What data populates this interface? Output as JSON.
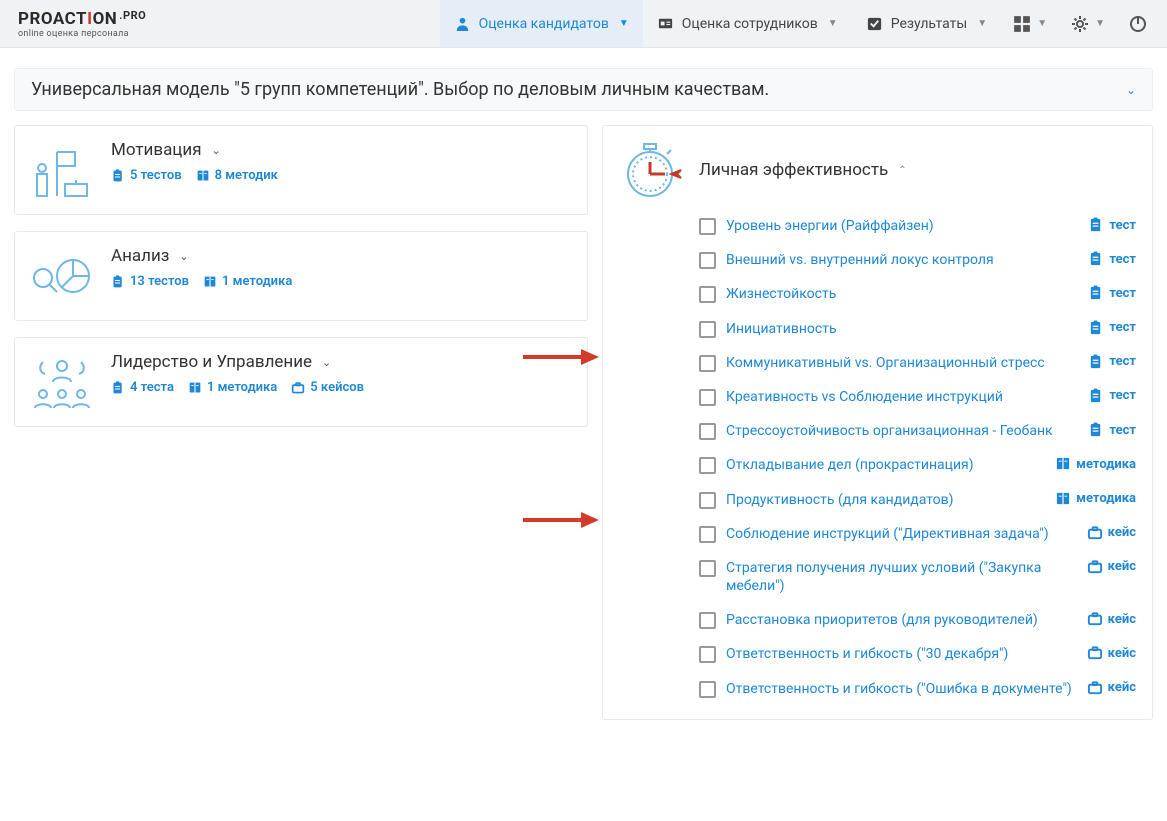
{
  "header": {
    "logo_main": "PROACTION",
    "logo_ext": ".PRO",
    "logo_sub": "online оценка персонала",
    "nav": [
      {
        "label": "Оценка кандидатов",
        "active": true,
        "icon": "user"
      },
      {
        "label": "Оценка сотрудников",
        "active": false,
        "icon": "id"
      },
      {
        "label": "Результаты",
        "active": false,
        "icon": "check"
      }
    ]
  },
  "page_title": "Универсальная модель \"5 групп компетенций\". Выбор по деловым личным качествам.",
  "left_cards": [
    {
      "title": "Мотивация",
      "meta": [
        {
          "n": "5 тестов",
          "icon": "clip"
        },
        {
          "n": "8 методик",
          "icon": "book"
        }
      ]
    },
    {
      "title": "Анализ",
      "meta": [
        {
          "n": "13 тестов",
          "icon": "clip"
        },
        {
          "n": "1 методика",
          "icon": "book"
        }
      ]
    },
    {
      "title": "Лидерство и Управление",
      "meta": [
        {
          "n": "4 теста",
          "icon": "clip"
        },
        {
          "n": "1 методика",
          "icon": "book"
        },
        {
          "n": "5 кейсов",
          "icon": "case"
        }
      ]
    }
  ],
  "right_card": {
    "title": "Личная эффективность",
    "items": [
      {
        "label": "Уровень энергии (Райффайзен)",
        "tag": "тест",
        "tagicon": "clip"
      },
      {
        "label": "Внешний vs. внутренний локус контроля",
        "tag": "тест",
        "tagicon": "clip"
      },
      {
        "label": "Жизнестойкость",
        "tag": "тест",
        "tagicon": "clip"
      },
      {
        "label": "Инициативность",
        "tag": "тест",
        "tagicon": "clip"
      },
      {
        "label": "Коммуникативный vs. Организационный стресс",
        "tag": "тест",
        "tagicon": "clip"
      },
      {
        "label": "Креативность vs Соблюдение инструкций",
        "tag": "тест",
        "tagicon": "clip"
      },
      {
        "label": "Стрессоустойчивость организационная - Геобанк",
        "tag": "тест",
        "tagicon": "clip"
      },
      {
        "label": "Откладывание дел (прокрастинация)",
        "tag": "методика",
        "tagicon": "book"
      },
      {
        "label": "Продуктивность (для кандидатов)",
        "tag": "методика",
        "tagicon": "book"
      },
      {
        "label": "Соблюдение инструкций (\"Директивная задача\")",
        "tag": "кейс",
        "tagicon": "case"
      },
      {
        "label": "Стратегия получения лучших условий (\"Закупка мебели\")",
        "tag": "кейс",
        "tagicon": "case"
      },
      {
        "label": "Расстановка приоритетов (для руководителей)",
        "tag": "кейс",
        "tagicon": "case"
      },
      {
        "label": "Ответственность и гибкость (\"30 декабря\")",
        "tag": "кейс",
        "tagicon": "case"
      },
      {
        "label": "Ответственность и гибкость (\"Ошибка в документе\")",
        "tag": "кейс",
        "tagicon": "case"
      }
    ]
  }
}
